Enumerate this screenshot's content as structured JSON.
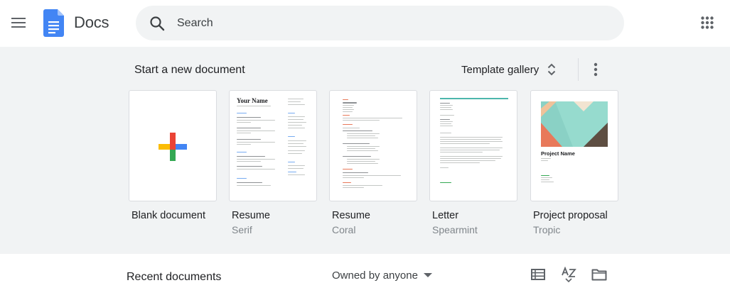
{
  "header": {
    "menu_icon": "hamburger-menu-icon",
    "app_title": "Docs",
    "search": {
      "placeholder": "Search",
      "value": ""
    },
    "apps_icon": "apps-grid-icon"
  },
  "templates": {
    "title": "Start a new document",
    "gallery_label": "Template gallery",
    "items": [
      {
        "name": "Blank document",
        "subtitle": ""
      },
      {
        "name": "Resume",
        "subtitle": "Serif",
        "heading": "Your Name"
      },
      {
        "name": "Resume",
        "subtitle": "Coral"
      },
      {
        "name": "Letter",
        "subtitle": "Spearmint"
      },
      {
        "name": "Project proposal",
        "subtitle": "Tropic",
        "heading": "Project Name"
      }
    ]
  },
  "recent": {
    "title": "Recent documents",
    "owner_filter": "Owned by anyone"
  },
  "colors": {
    "docs_blue": "#4285f4",
    "header_bg": "#ffffff",
    "section_bg": "#f1f3f4",
    "plus_red": "#ea4335",
    "plus_blue": "#4285f4",
    "plus_green": "#34a853",
    "plus_yellow": "#fbbc04",
    "spearmint": "#4db6ac"
  }
}
